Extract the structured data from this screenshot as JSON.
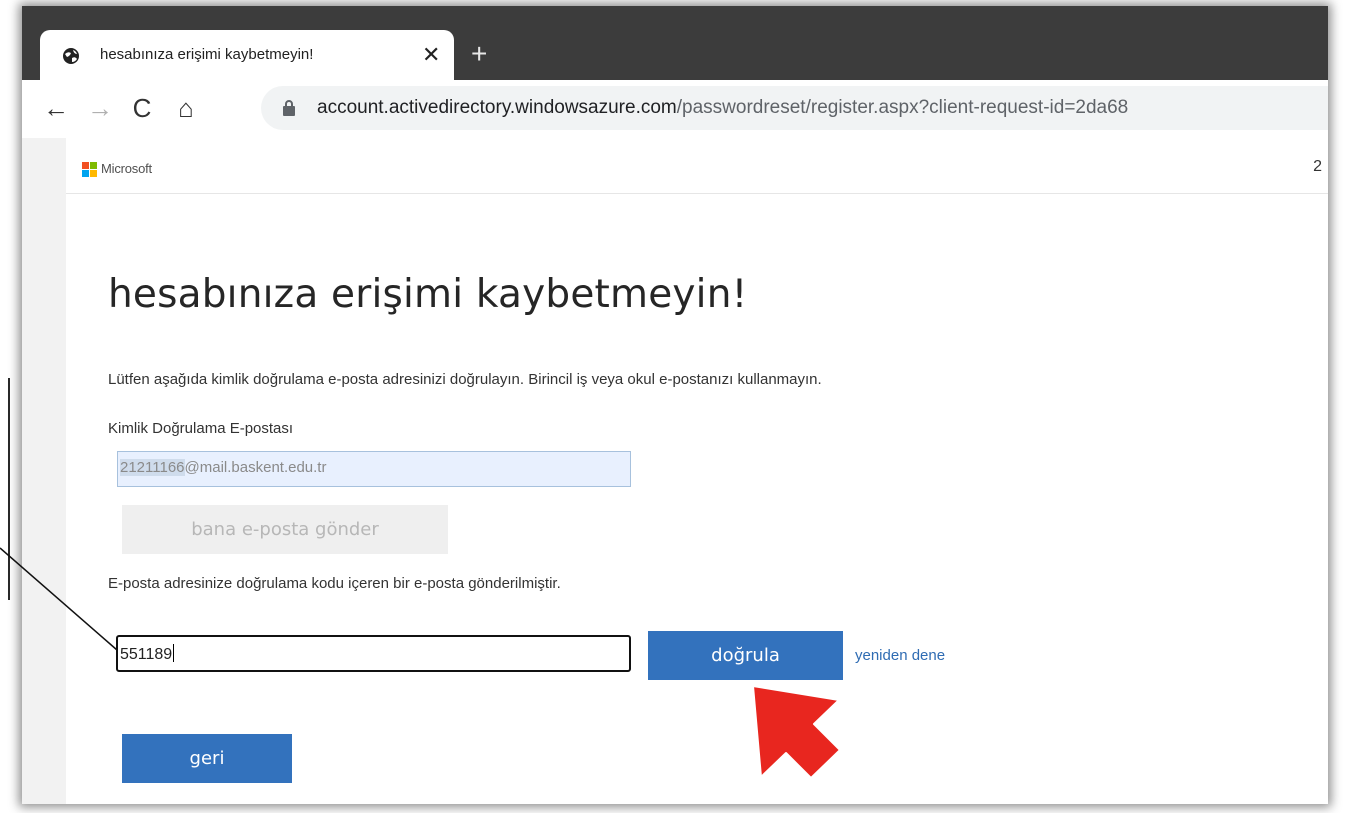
{
  "browser": {
    "tab_title": "hesabınıza erişimi kaybetmeyin!",
    "tab_close": "✕",
    "new_tab": "+",
    "back": "←",
    "forward": "→",
    "reload": "C",
    "home": "⌂",
    "url_domain": "account.activedirectory.windowsazure.com",
    "url_path": "/passwordreset/register.aspx?client-request-id=2da68"
  },
  "header": {
    "brand": "Microsoft",
    "right_text": "2"
  },
  "main": {
    "title": "hesabınıza erişimi kaybetmeyin!",
    "instruction": "Lütfen aşağıda kimlik doğrulama e-posta adresinizi doğrulayın. Birincil iş veya okul e-postanızı kullanmayın.",
    "email_label": "Kimlik Doğrulama E-postası",
    "email_user": "21211166",
    "email_domain": "@mail.baskent.edu.tr",
    "send_button": "bana e-posta gönder",
    "sent_info": "E-posta adresinize doğrulama kodu içeren bir e-posta gönderilmiştir.",
    "code_value": "551189",
    "verify_button": "doğrula",
    "retry_link": "yeniden dene",
    "back_button": "geri"
  },
  "colors": {
    "primary_button": "#3372bd",
    "link": "#2f6cb3",
    "annotation_arrow": "#e8261f"
  },
  "icons": {
    "tab": "globe-icon",
    "omnibox": "lock-icon",
    "annotation": "red-arrow-icon"
  }
}
